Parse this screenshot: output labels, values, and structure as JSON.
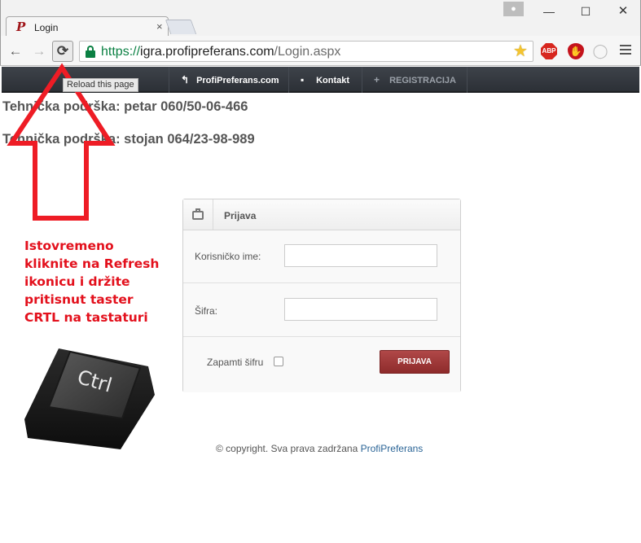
{
  "browser": {
    "tab_title": "Login",
    "tab_close": "×",
    "url_scheme": "https://",
    "url_host": "igra.profipreferans.com",
    "url_path": "/Login.aspx",
    "tooltip": "Reload this page",
    "ext_abp": "ABP",
    "icons": {
      "back": "←",
      "forward": "→",
      "reload": "⟳",
      "star": "★",
      "minimize": "—",
      "maximize": "☐",
      "close": "✕",
      "user": "👤"
    }
  },
  "navbar": {
    "items": [
      {
        "label": "ProfiPreferans.com",
        "icon": "↰"
      },
      {
        "label": "Kontakt",
        "icon": "▪"
      },
      {
        "label": "REGISTRACIJA",
        "icon": "+"
      }
    ]
  },
  "support": {
    "line1": "Tehnička podrška: petar 060/50-06-466",
    "line2": "Tehnička podrška: stojan 064/23-98-989"
  },
  "login": {
    "title": "Prijava",
    "username_label": "Korisničko ime:",
    "username_value": "",
    "password_label": "Šifra:",
    "password_value": "",
    "remember_label": "Zapamti šifru",
    "remember_checked": false,
    "submit_label": "PRIJAVA"
  },
  "footer": {
    "text": "© copyright. Sva prava zadržana ",
    "link": "ProfiPreferans"
  },
  "annotation": {
    "instruction": "Istovremeno kliknite na Refresh ikonicu i držite pritisnut taster CRTL na tastaturi",
    "key_label": "Ctrl",
    "arrow_color": "#ee1c25"
  }
}
